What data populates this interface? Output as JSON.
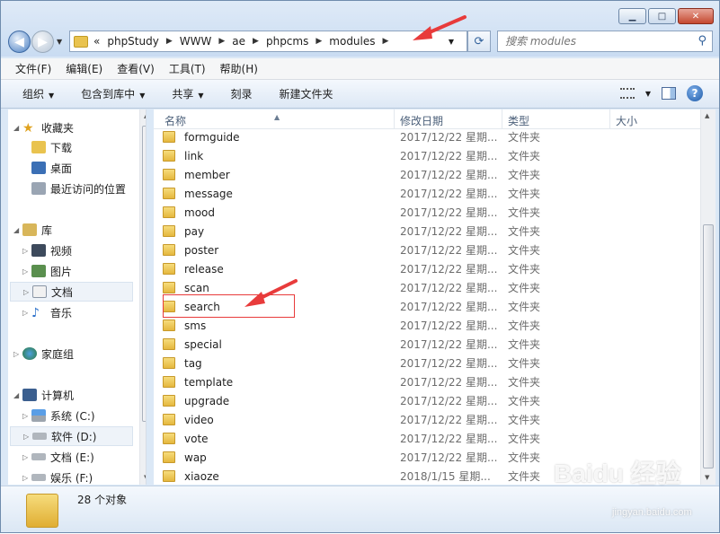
{
  "window": {
    "minimize_icon": "minimize-icon",
    "maximize_icon": "maximize-icon",
    "close_icon": "close-icon"
  },
  "address": {
    "overflow": "«",
    "crumbs": [
      "phpStudy",
      "WWW",
      "ae",
      "phpcms",
      "modules"
    ]
  },
  "search": {
    "placeholder": "搜索 modules"
  },
  "menu": [
    "文件(F)",
    "编辑(E)",
    "查看(V)",
    "工具(T)",
    "帮助(H)"
  ],
  "toolbar": {
    "organize": "组织",
    "include_library": "包含到库中",
    "share": "共享",
    "burn": "刻录",
    "new_folder": "新建文件夹"
  },
  "nav": {
    "favorites": "收藏夹",
    "downloads": "下载",
    "desktop": "桌面",
    "recent": "最近访问的位置",
    "libraries": "库",
    "videos": "视频",
    "pictures": "图片",
    "documents": "文档",
    "music": "音乐",
    "homegroup": "家庭组",
    "computer": "计算机",
    "drive_c": "系统 (C:)",
    "drive_d": "软件 (D:)",
    "drive_e": "文档 (E:)",
    "drive_f": "娱乐 (F:)"
  },
  "columns": {
    "name": "名称",
    "date": "修改日期",
    "type": "类型",
    "size": "大小"
  },
  "files": [
    {
      "name": "formguide",
      "date": "2017/12/22 星期...",
      "type": "文件夹"
    },
    {
      "name": "link",
      "date": "2017/12/22 星期...",
      "type": "文件夹"
    },
    {
      "name": "member",
      "date": "2017/12/22 星期...",
      "type": "文件夹"
    },
    {
      "name": "message",
      "date": "2017/12/22 星期...",
      "type": "文件夹"
    },
    {
      "name": "mood",
      "date": "2017/12/22 星期...",
      "type": "文件夹"
    },
    {
      "name": "pay",
      "date": "2017/12/22 星期...",
      "type": "文件夹"
    },
    {
      "name": "poster",
      "date": "2017/12/22 星期...",
      "type": "文件夹"
    },
    {
      "name": "release",
      "date": "2017/12/22 星期...",
      "type": "文件夹"
    },
    {
      "name": "scan",
      "date": "2017/12/22 星期...",
      "type": "文件夹"
    },
    {
      "name": "search",
      "date": "2017/12/22 星期...",
      "type": "文件夹"
    },
    {
      "name": "sms",
      "date": "2017/12/22 星期...",
      "type": "文件夹"
    },
    {
      "name": "special",
      "date": "2017/12/22 星期...",
      "type": "文件夹"
    },
    {
      "name": "tag",
      "date": "2017/12/22 星期...",
      "type": "文件夹"
    },
    {
      "name": "template",
      "date": "2017/12/22 星期...",
      "type": "文件夹"
    },
    {
      "name": "upgrade",
      "date": "2017/12/22 星期...",
      "type": "文件夹"
    },
    {
      "name": "video",
      "date": "2017/12/22 星期...",
      "type": "文件夹"
    },
    {
      "name": "vote",
      "date": "2017/12/22 星期...",
      "type": "文件夹"
    },
    {
      "name": "wap",
      "date": "2017/12/22 星期...",
      "type": "文件夹"
    },
    {
      "name": "xiaoze",
      "date": "2018/1/15 星期...",
      "type": "文件夹"
    }
  ],
  "status": {
    "count": "28 个对象"
  },
  "watermark": {
    "main": "Baidu 经验",
    "sub": "jingyan.baidu.com"
  },
  "colors": {
    "annotation": "#e83b3b",
    "folder": "#e5b73e",
    "chrome": "#dbe8f6"
  }
}
